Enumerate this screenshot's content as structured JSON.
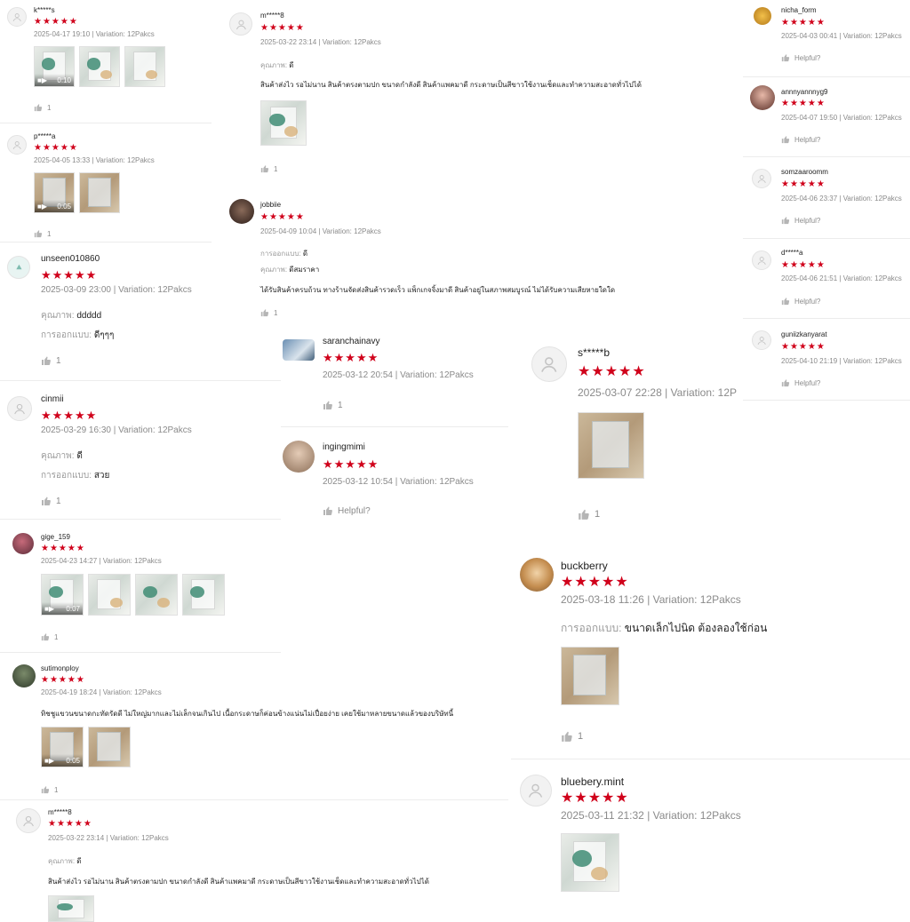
{
  "stars": "★★★★★",
  "helpful": "Helpful?",
  "reviews": [
    {
      "user": "k*****s",
      "date": "2025-04-17 19:10 | Variation: 12Pakcs",
      "likes": "1",
      "video": "0:10"
    },
    {
      "user": "p*****a",
      "date": "2025-04-05 13:33 | Variation: 12Pakcs",
      "likes": "1",
      "video": "0:05"
    },
    {
      "user": "unseen010860",
      "date": "2025-03-09 23:00 | Variation: 12Pakcs",
      "q_label": "คุณภาพ:",
      "q_value": "ddddd",
      "d_label": "การออกแบบ:",
      "d_value": "ดีๆๆๆ",
      "likes": "1"
    },
    {
      "user": "cinmii",
      "date": "2025-03-29 16:30 | Variation: 12Pakcs",
      "q_label": "คุณภาพ:",
      "q_value": "ดี",
      "d_label": "การออกแบบ:",
      "d_value": "สวย",
      "likes": "1"
    },
    {
      "user": "gige_159",
      "date": "2025-04-23 14:27 | Variation: 12Pakcs",
      "likes": "1",
      "video": "0:07"
    },
    {
      "user": "sutimonploy",
      "date": "2025-04-19 18:24 | Variation: 12Pakcs",
      "text": "ทิชชูแขวนขนาดกะทัดรัดดี ไม่ใหญ่มากและไม่เล็กจนเกินไป เนื้อกระดาษก็ค่อนข้างแน่นไม่เปื่อยง่าย เคยใช้มาหลายขนาดแล้วของบริษัทนี้",
      "likes": "1",
      "video": "0:05"
    },
    {
      "user": "m*****8",
      "date": "2025-03-22 23:14 | Variation: 12Pakcs",
      "q_label": "คุณภาพ:",
      "q_value": "ดี",
      "text": "สินค้าส่งไว รอไม่นาน สินค้าตรงตามปก ขนาดกำลังดี สินค้าแพคมาดี กระดาษเป็นสีขาวใช้งานเช็ดและทำความสะอาดทั่วไปได้",
      "likes": "1"
    },
    {
      "user": "jobbiie",
      "date": "2025-04-09 10:04 | Variation: 12Pakcs",
      "d_label": "การออกแบบ:",
      "d_value": "ดี",
      "q_label": "คุณภาพ:",
      "q_value": "ดีสมราคา",
      "text": "ได้รับสินค้าครบถ้วน ทางร้านจัดส่งสินค้ารวดเร็ว แพ็กเกจจิ้งมาดี สินค้าอยู่ในสภาพสมบูรณ์ ไม่ได้รับความเสียหายใดใด",
      "likes": "1"
    },
    {
      "user": "saranchainavy",
      "date": "2025-03-12 20:54 | Variation: 12Pakcs",
      "likes": "1"
    },
    {
      "user": "ingingmimi",
      "date": "2025-03-12 10:54 | Variation: 12Pakcs"
    },
    {
      "user": "s*****b",
      "date": "2025-03-07 22:28 | Variation: 12P",
      "likes": "1"
    },
    {
      "user": "buckberry",
      "date": "2025-03-18 11:26 | Variation: 12Pakcs",
      "d_label": "การออกแบบ:",
      "d_value": "ขนาดเล็กไปนิด ต้องลองใช้ก่อน",
      "likes": "1"
    },
    {
      "user": "bluebery.mint",
      "date": "2025-03-11 21:32 | Variation: 12Pakcs"
    },
    {
      "user": "nicha_form",
      "date": "2025-04-03 00:41 | Variation: 12Pakcs"
    },
    {
      "user": "annnyannnyg9",
      "date": "2025-04-07 19:50 | Variation: 12Pakcs"
    },
    {
      "user": "somzaaroomm",
      "date": "2025-04-06 23:37 | Variation: 12Pakcs"
    },
    {
      "user": "d*****a",
      "date": "2025-04-06 21:51 | Variation: 12Pakcs"
    },
    {
      "user": "guniizkanyarat",
      "date": "2025-04-10 21:19 | Variation: 12Pakcs"
    }
  ]
}
